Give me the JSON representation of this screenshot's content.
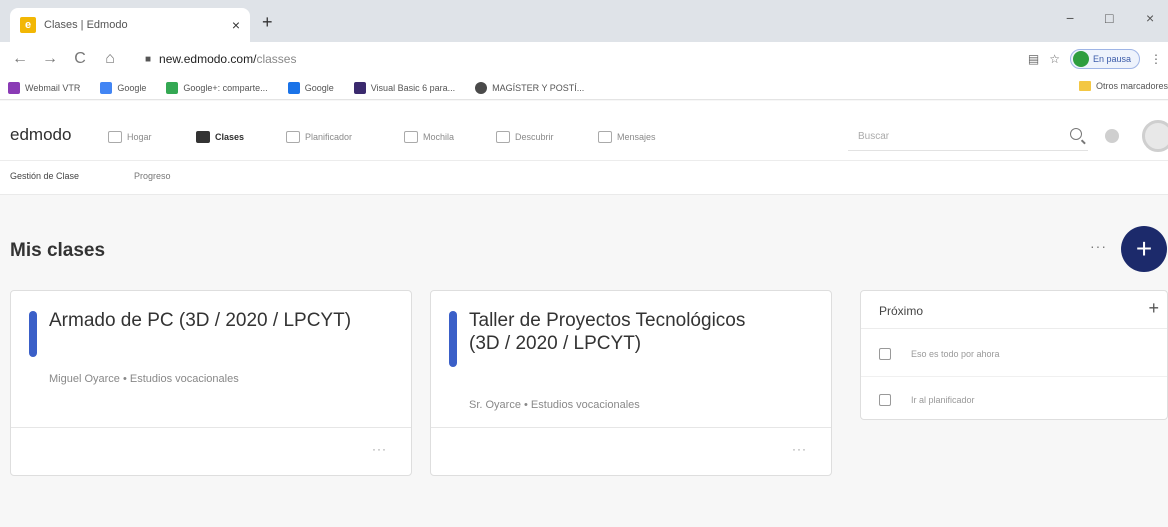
{
  "browser": {
    "tab_title": "Clases | Edmodo",
    "tab_close": "×",
    "new_tab": "+",
    "window_controls": [
      "−",
      "□",
      "×"
    ],
    "url_host": "new.edmodo.com/",
    "url_path": "classes",
    "profile_label": "En pausa",
    "nav": {
      "back": "←",
      "forward": "→",
      "reload": "C",
      "home": "⌂"
    }
  },
  "bookmarks": {
    "items": [
      {
        "label": "Webmail VTR",
        "color": "#8a3bb5"
      },
      {
        "label": "Google",
        "color": "#4285f4"
      },
      {
        "label": "Google+: comparte...",
        "color": "#34a853"
      },
      {
        "label": "Google",
        "color": "#1a73e8"
      },
      {
        "label": "Visual Basic 6 para...",
        "color": "#3b2a6e"
      },
      {
        "label": "MAGÍSTER Y POSTÍ...",
        "color": "#4a4a4a"
      }
    ],
    "other": "Otros marcadores"
  },
  "app": {
    "logo": "edmodo",
    "nav": [
      "Hogar",
      "Clases",
      "Planificador",
      "Mochila",
      "Descubrir",
      "Mensajes"
    ],
    "active_nav": "Clases",
    "search_placeholder": "Buscar"
  },
  "subnav": {
    "tabs": [
      "Gestión de Clase",
      "Progreso"
    ]
  },
  "main": {
    "title": "Mis clases",
    "more": "···",
    "add": "+",
    "classes": [
      {
        "name": "Armado de PC (3D / 2020 / LPCYT)",
        "meta": "Miguel Oyarce • Estudios vocacionales",
        "more": "···"
      },
      {
        "name": "Taller de Proyectos Tecnológicos (3D / 2020 / LPCYT)",
        "meta": "Sr. Oyarce • Estudios vocacionales",
        "more": "···"
      }
    ],
    "upcoming": {
      "title": "Próximo",
      "add": "+",
      "rows": [
        "Eso es todo por ahora",
        "Ir al planificador"
      ]
    }
  },
  "colors": {
    "accent": "#3a5fc8",
    "fab": "#1c2a6b"
  }
}
